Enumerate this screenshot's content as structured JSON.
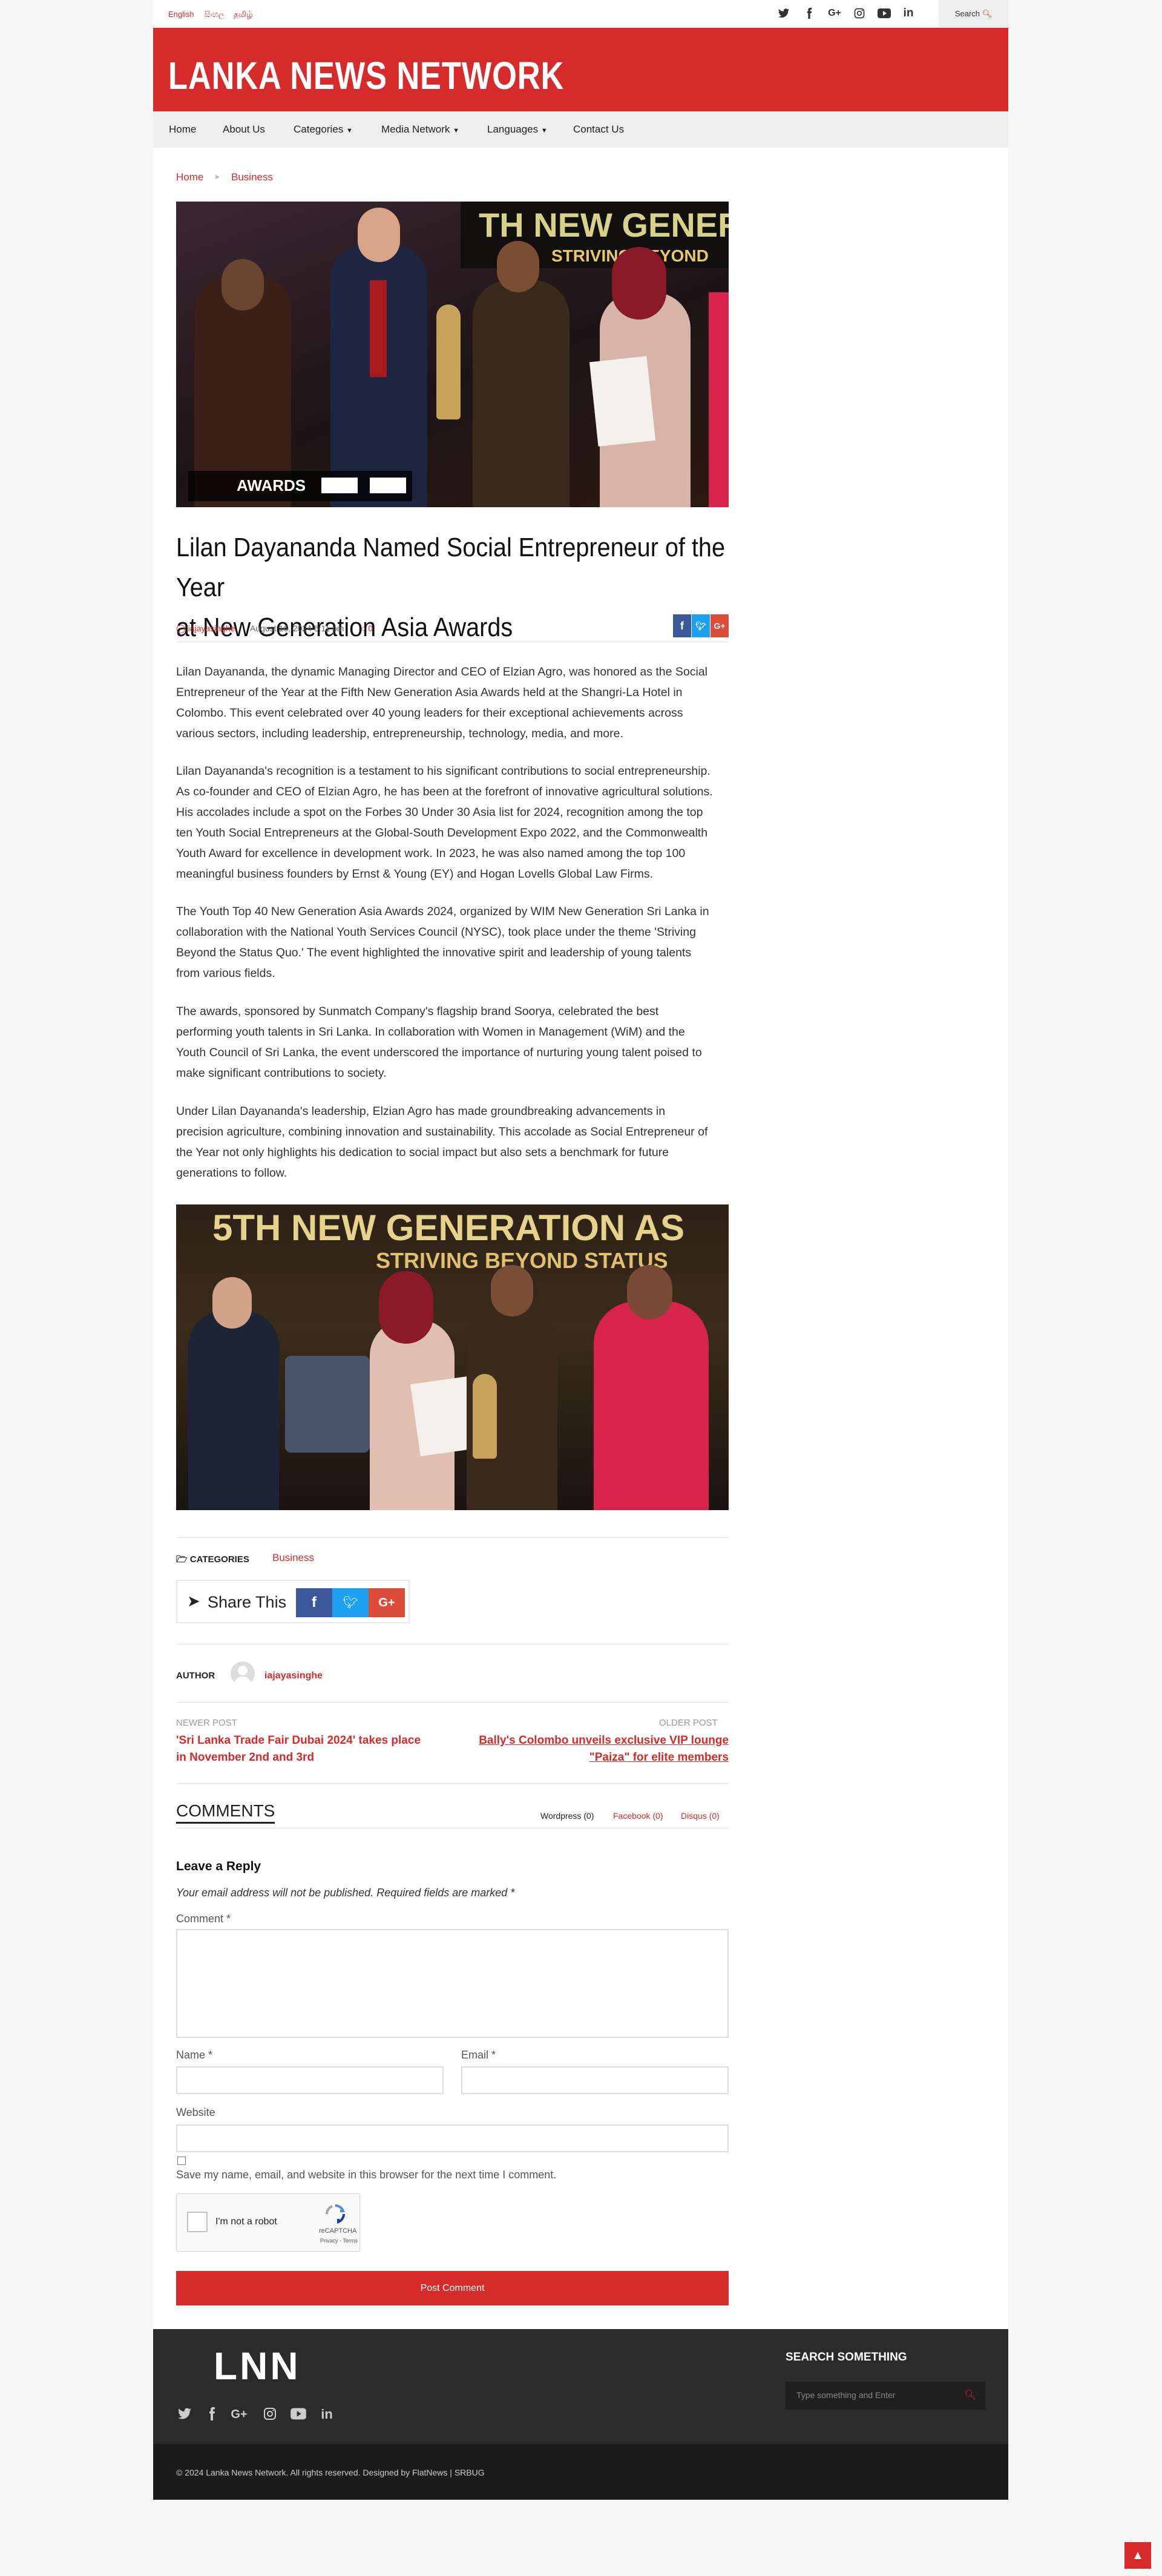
{
  "topbar": {
    "languages": [
      "English",
      "සිංහල",
      "தமிழ்"
    ],
    "social_icons": [
      "twitter-icon",
      "facebook-icon",
      "google-plus-icon",
      "instagram-icon",
      "youtube-icon",
      "linkedin-icon"
    ],
    "search_label": "Search"
  },
  "header": {
    "logo": "LANKA NEWS NETWORK"
  },
  "nav": {
    "items": [
      "Home",
      "About Us",
      "Categories",
      "Media Network",
      "Languages",
      "Contact Us"
    ]
  },
  "breadcrumb": {
    "home": "Home",
    "section": "Business"
  },
  "article": {
    "title_line1": "Lilan Dayananda Named Social Entrepreneur of the Year",
    "title_line2": "at New Generation Asia Awards",
    "author": "iajayasinghe",
    "date": "August 16, 2024 6:11 pm",
    "comments_count": "0",
    "paragraphs": [
      [
        "Lilan Dayananda, the dynamic Managing Director and CEO of Elzian Agro, was honored as the Social",
        "Entrepreneur of the Year at the Fifth New Generation Asia Awards held at the Shangri-La Hotel in",
        "Colombo. This event celebrated over 40 young leaders for their exceptional achievements across",
        "various sectors, including leadership, entrepreneurship, technology, media, and more."
      ],
      [
        "Lilan Dayananda's recognition is a testament to his significant contributions to social entrepreneurship.",
        "As co-founder and CEO of Elzian Agro, he has been at the forefront of innovative agricultural solutions.",
        "His accolades include a spot on the Forbes 30 Under 30 Asia list for 2024, recognition among the top",
        "ten Youth Social Entrepreneurs at the Global-South Development Expo 2022, and the Commonwealth",
        "Youth Award for excellence in development work. In 2023, he was also named among the top 100",
        "meaningful business founders by Ernst & Young (EY) and Hogan Lovells Global Law Firms."
      ],
      [
        "The Youth Top 40 New Generation Asia Awards 2024, organized by WIM New Generation Sri Lanka in",
        "collaboration with the National Youth Services Council (NYSC), took place under the theme 'Striving",
        "Beyond the Status Quo.' The event highlighted the innovative spirit and leadership of young talents",
        "from various fields."
      ],
      [
        "The awards, sponsored by Sunmatch Company's flagship brand Soorya, celebrated the best",
        "performing youth talents in Sri Lanka. In collaboration with Women in Management (WiM) and the",
        "Youth Council of Sri Lanka, the event underscored the importance of nurturing young talent poised to",
        "make significant contributions to society."
      ],
      [
        "Under Lilan Dayananda's leadership, Elzian Agro has made groundbreaking advancements in",
        "precision agriculture, combining innovation and sustainability. This accolade as Social Entrepreneur of",
        "the Year not only highlights his dedication to social impact but also sets a benchmark for future",
        "generations to follow."
      ]
    ],
    "banner_text1": "TH NEW GENERAT",
    "banner_sub1": "STRIVING BEYOND",
    "banner_text2": "5TH NEW GENERATION AS",
    "banner_sub2": "STRIVING BEYOND STATUS",
    "awards_label": "AWARDS"
  },
  "categories": {
    "label": "CATEGORIES",
    "value": "Business"
  },
  "share": {
    "label": "Share This"
  },
  "author_box": {
    "label": "AUTHOR",
    "name": "iajayasinghe"
  },
  "post_nav": {
    "newer_label": "NEWER POST",
    "newer_title1": "'Sri Lanka Trade Fair Dubai 2024' takes place",
    "newer_title2": "in November 2nd and 3rd",
    "older_label": "OLDER POST",
    "older_title1": "Bally's Colombo unveils exclusive VIP lounge",
    "older_title2": "\"Paiza\" for elite members"
  },
  "comments": {
    "heading": "COMMENTS",
    "tabs": [
      "Wordpress (0)",
      "Facebook (0)",
      "Disqus (0)"
    ],
    "reply_title": "Leave a Reply",
    "note": "Your email address will not be published. Required fields are marked *",
    "comment_label": "Comment *",
    "name_label": "Name *",
    "email_label": "Email *",
    "website_label": "Website",
    "save_label": "Save my name, email, and website in this browser for the next time I comment.",
    "captcha_label": "I'm not a robot",
    "captcha_brand": "reCAPTCHA",
    "captcha_terms": "Privacy - Terms",
    "submit": "Post Comment"
  },
  "footer": {
    "logo": "LNN",
    "search_title": "SEARCH SOMETHING",
    "search_placeholder": "Type something and Enter",
    "copyright": "© 2024 Lanka News Network. All rights reserved. Designed by FlatNews | SRBUG"
  },
  "colors": {
    "brand": "#d52b2b",
    "facebook": "#3b5998",
    "twitter": "#1da1f2",
    "google": "#dd4b39",
    "footer": "#2b2b2b"
  }
}
